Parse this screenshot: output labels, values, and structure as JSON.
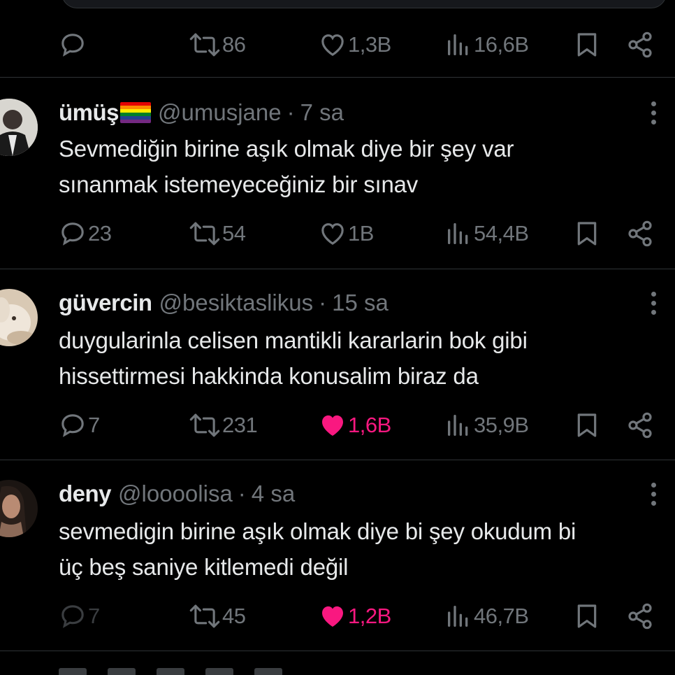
{
  "posts_prev": {
    "metrics": {
      "reply": "",
      "repost": "86",
      "like": "1,3B",
      "views": "16,6B"
    }
  },
  "posts": [
    {
      "name": "ümüş",
      "handle": "@umusjane",
      "separator": "·",
      "time": "7 sa",
      "text_lines": [
        "Sevmediğin birine aşık olmak diye bir şey var",
        "sınanmak  istemeyeceğiniz bir sınav"
      ],
      "metrics": {
        "reply": "23",
        "repost": "54",
        "like": "1B",
        "views": "54,4B"
      },
      "liked": false
    },
    {
      "name": "güvercin",
      "handle": "@besiktaslikus",
      "separator": "·",
      "time": "15 sa",
      "text_lines": [
        "duygularinla celisen mantikli kararlarin bok gibi",
        "hissettirmesi hakkinda konusalim biraz da"
      ],
      "metrics": {
        "reply": "7",
        "repost": "231",
        "like": "1,6B",
        "views": "35,9B"
      },
      "liked": true
    },
    {
      "name": "deny",
      "handle": "@loooolisa",
      "separator": "·",
      "time": "4 sa",
      "text_lines": [
        "sevmedigin birine aşık olmak diye bi şey okudum bi",
        "üç beş saniye kitlemedi değil"
      ],
      "metrics": {
        "reply": "7",
        "repost": "45",
        "like": "1,2B",
        "views": "46,7B"
      },
      "liked": true
    }
  ],
  "colors": {
    "background": "#000000",
    "text": "#e7e9ea",
    "muted": "#71767b",
    "like_active": "#f91880",
    "divider": "#2f3336"
  },
  "icons": {
    "reply": "reply-bubble-icon",
    "repost": "repost-arrows-icon",
    "like": "heart-icon",
    "views": "views-bars-icon",
    "bookmark": "bookmark-icon",
    "share": "share-icon",
    "more": "more-dots-icon",
    "flag": "rainbow-flag-emoji"
  }
}
